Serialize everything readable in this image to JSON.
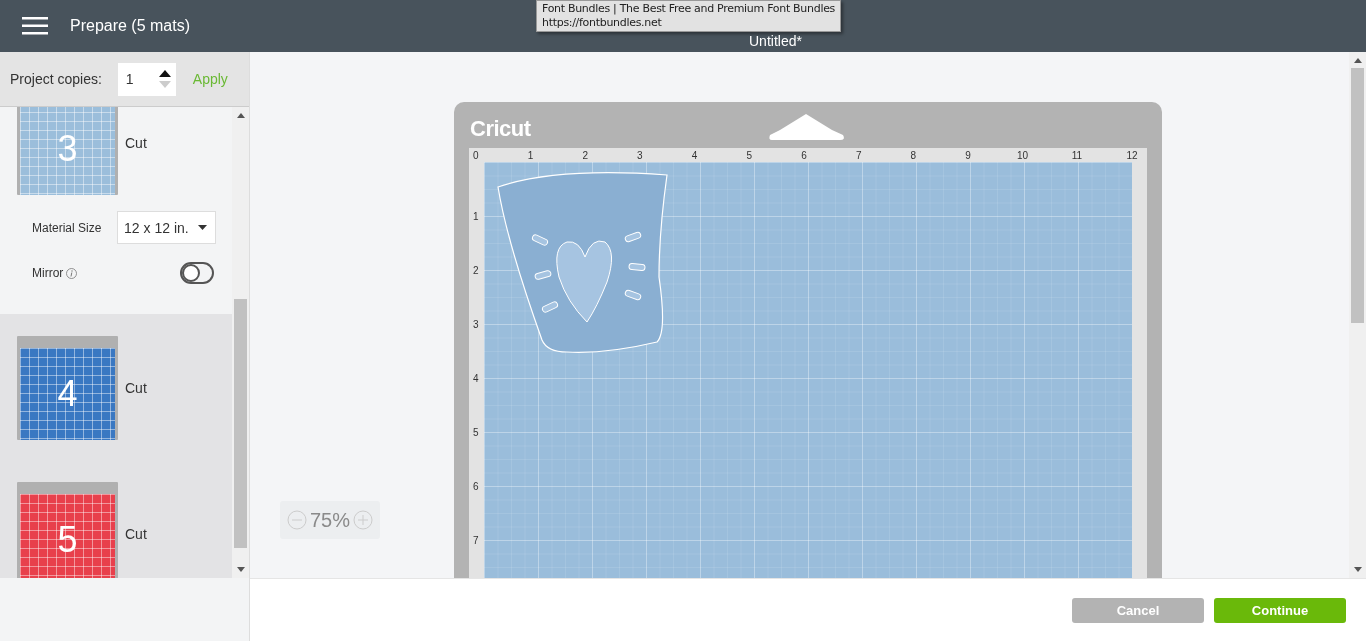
{
  "header": {
    "title": "Prepare (5 mats)",
    "document_title": "Untitled*"
  },
  "tooltip": {
    "title": "Font Bundles | The Best Free and Premium Font Bundles",
    "url": "https://fontbundles.net"
  },
  "copies": {
    "label": "Project copies:",
    "value": "1",
    "apply": "Apply"
  },
  "mats": [
    {
      "number": "3",
      "mode": "Cut",
      "color": "#9bbedb",
      "selected": true,
      "settings": {
        "material_size_label": "Material Size",
        "material_size": "12 x 12 in.",
        "mirror_label": "Mirror",
        "mirror_on": false
      }
    },
    {
      "number": "4",
      "mode": "Cut",
      "color": "#3a78c2",
      "selected": false
    },
    {
      "number": "5",
      "mode": "Cut",
      "color": "#e8404c",
      "selected": false
    }
  ],
  "canvas": {
    "logo": "Cricut",
    "x_ruler": [
      "0",
      "1",
      "2",
      "3",
      "4",
      "5",
      "6",
      "7",
      "8",
      "9",
      "10",
      "11",
      "12"
    ],
    "y_ruler": [
      "1",
      "2",
      "3",
      "4",
      "5",
      "6",
      "7"
    ],
    "zoom": "75%"
  },
  "buttons": {
    "cancel": "Cancel",
    "continue": "Continue"
  }
}
